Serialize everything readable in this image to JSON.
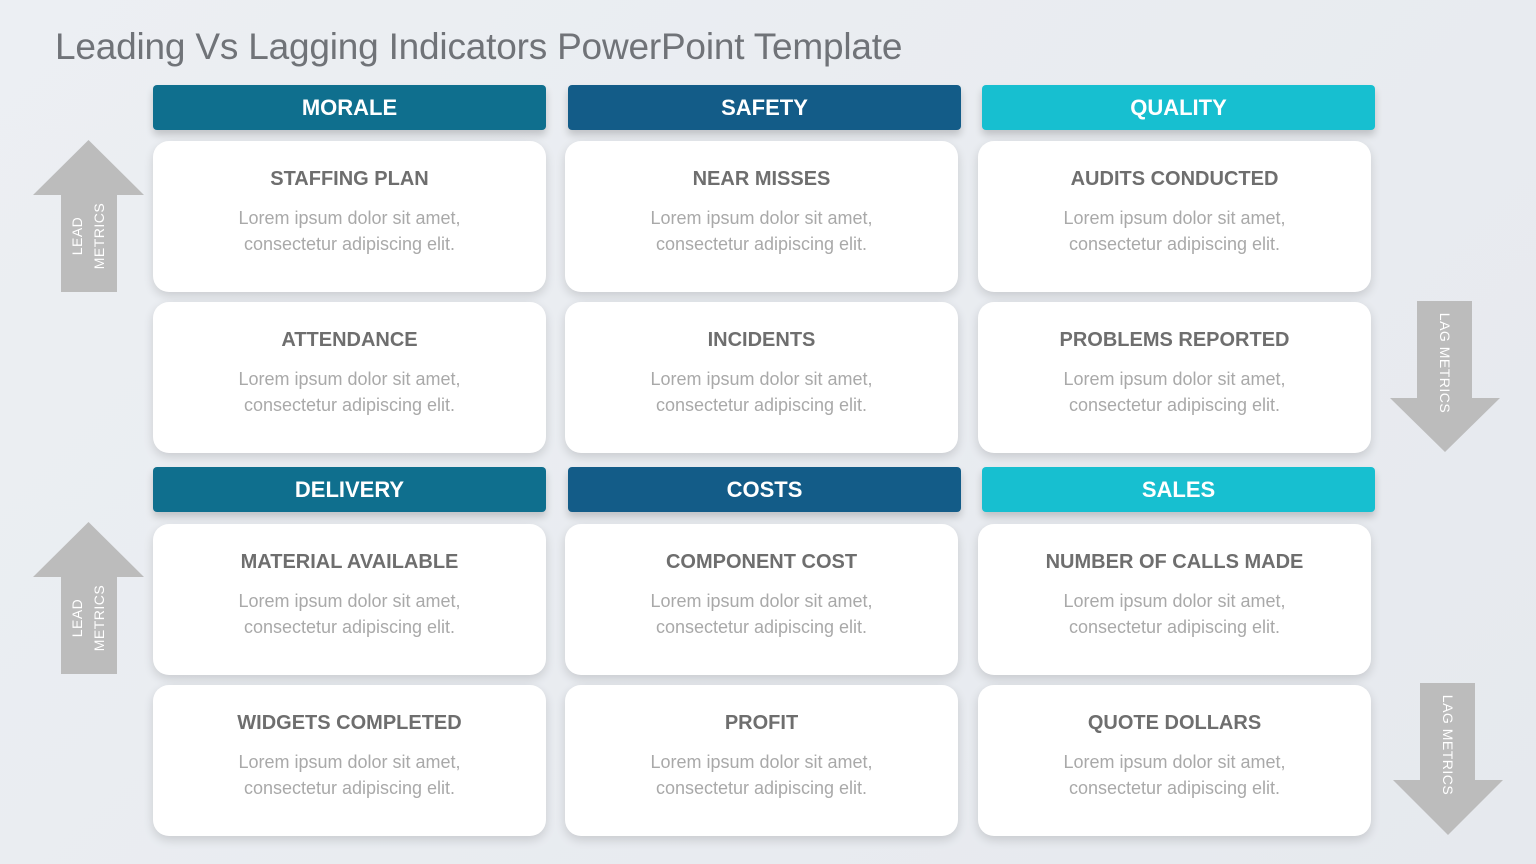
{
  "title": "Leading Vs Lagging Indicators PowerPoint Template",
  "colors": {
    "dark_teal": "#0f6f8e",
    "navy": "#135c88",
    "cyan": "#17bfd0",
    "arrow_gray": "#bcbcbc",
    "card_title": "#6e6e6e",
    "card_body": "#a9a9a9"
  },
  "arrows": {
    "lead_top": {
      "line1": "LEAD",
      "line2": "METRICS",
      "icon": "up-arrow"
    },
    "lead_bottom": {
      "line1": "LEAD",
      "line2": "METRICS",
      "icon": "up-arrow"
    },
    "lag_top": {
      "label": "LAG METRICS",
      "icon": "down-arrow"
    },
    "lag_bottom": {
      "label": "LAG METRICS",
      "icon": "down-arrow"
    }
  },
  "sections": [
    {
      "header": "MORALE",
      "cards": [
        {
          "title": "STAFFING PLAN",
          "line1": "Lorem ipsum dolor sit amet,",
          "line2": "consectetur adipiscing elit."
        },
        {
          "title": "ATTENDANCE",
          "line1": "Lorem ipsum dolor sit amet,",
          "line2": "consectetur adipiscing elit."
        }
      ]
    },
    {
      "header": "SAFETY",
      "cards": [
        {
          "title": "NEAR MISSES",
          "line1": "Lorem ipsum dolor sit amet,",
          "line2": "consectetur adipiscing elit."
        },
        {
          "title": "INCIDENTS",
          "line1": "Lorem ipsum dolor sit amet,",
          "line2": "consectetur adipiscing elit."
        }
      ]
    },
    {
      "header": "QUALITY",
      "cards": [
        {
          "title": "AUDITS CONDUCTED",
          "line1": "Lorem ipsum dolor sit amet,",
          "line2": "consectetur adipiscing elit."
        },
        {
          "title": "PROBLEMS REPORTED",
          "line1": "Lorem ipsum dolor sit amet,",
          "line2": "consectetur adipiscing elit."
        }
      ]
    },
    {
      "header": "DELIVERY",
      "cards": [
        {
          "title": "MATERIAL AVAILABLE",
          "line1": "Lorem ipsum dolor sit amet,",
          "line2": "consectetur adipiscing elit."
        },
        {
          "title": "WIDGETS COMPLETED",
          "line1": "Lorem ipsum dolor sit amet,",
          "line2": "consectetur adipiscing elit."
        }
      ]
    },
    {
      "header": "COSTS",
      "cards": [
        {
          "title": "COMPONENT COST",
          "line1": "Lorem ipsum dolor sit amet,",
          "line2": "consectetur adipiscing elit."
        },
        {
          "title": "PROFIT",
          "line1": "Lorem ipsum dolor sit amet,",
          "line2": "consectetur adipiscing elit."
        }
      ]
    },
    {
      "header": "SALES",
      "cards": [
        {
          "title": "NUMBER OF CALLS MADE",
          "line1": "Lorem ipsum dolor sit amet,",
          "line2": "consectetur adipiscing elit."
        },
        {
          "title": "QUOTE DOLLARS",
          "line1": "Lorem ipsum dolor sit amet,",
          "line2": "consectetur adipiscing elit."
        }
      ]
    }
  ]
}
